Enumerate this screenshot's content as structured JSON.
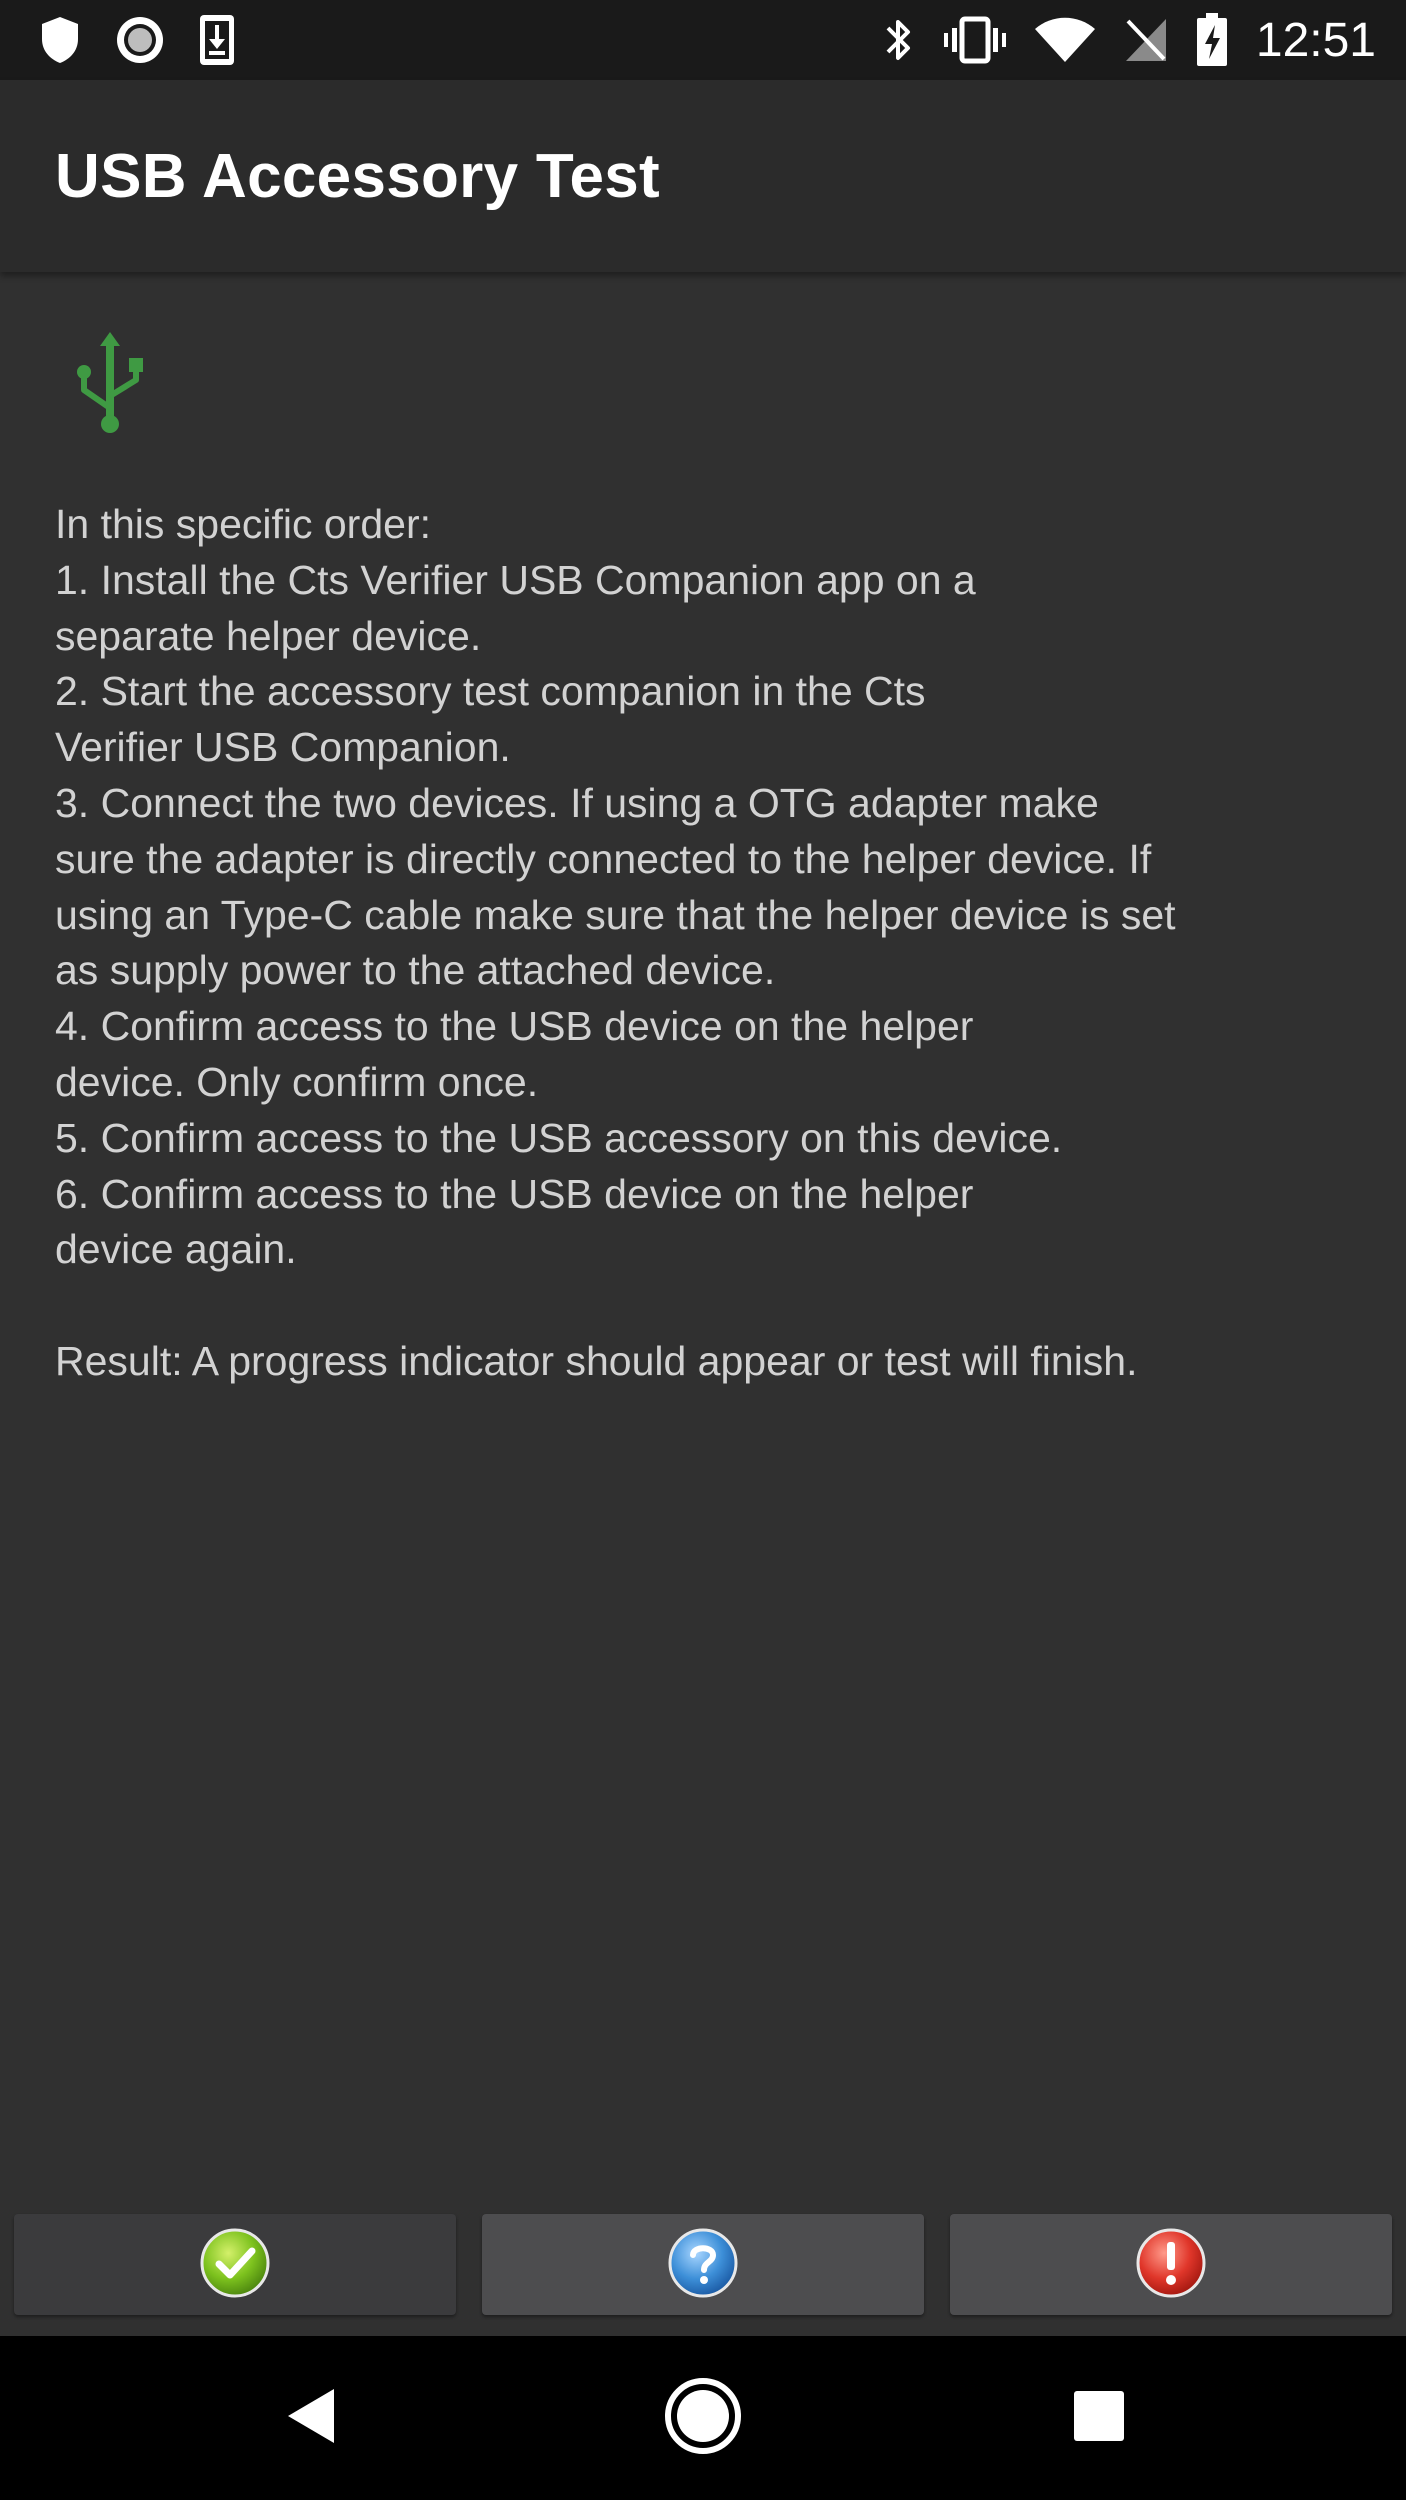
{
  "status_bar": {
    "time": "12:51",
    "left_icons": [
      "shield-icon",
      "record-icon",
      "download-icon"
    ],
    "right_icons": [
      "bluetooth-icon",
      "vibrate-icon",
      "wifi-icon",
      "no-sim-icon",
      "battery-charging-icon"
    ]
  },
  "app_bar": {
    "title": "USB Accessory Test"
  },
  "content": {
    "icon": "usb-icon",
    "icon_color": "#3f9a43",
    "instructions": "In this specific order:\n1. Install the Cts Verifier USB Companion app on a\nseparate helper device.\n2. Start the accessory test companion in the Cts\nVerifier USB Companion.\n3. Connect the two devices. If using a OTG adapter make\nsure the adapter is directly connected to the helper device. If\nusing an Type-C cable make sure that the helper device is set\nas supply power to the attached device.\n4. Confirm access to the USB device on the helper\ndevice. Only confirm once.\n5. Confirm access to the USB accessory on this device.\n6. Confirm access to the USB device on the helper\ndevice again.\n\nResult: A progress indicator should appear or test will finish."
  },
  "buttons": [
    {
      "id": "pass",
      "icon": "pass-check-icon",
      "color": "#7dc21e"
    },
    {
      "id": "info",
      "icon": "help-question-icon",
      "color": "#3d8fd8"
    },
    {
      "id": "fail",
      "icon": "fail-alert-icon",
      "color": "#e0362a"
    }
  ],
  "nav_bar": {
    "buttons": [
      "back-icon",
      "home-icon",
      "recents-icon"
    ]
  },
  "colors": {
    "background": "#303030",
    "app_bar": "#2b2b2b",
    "status_bar": "#1a1a1a",
    "nav_bar": "#000000",
    "button_bg": "#4d4d4f"
  }
}
